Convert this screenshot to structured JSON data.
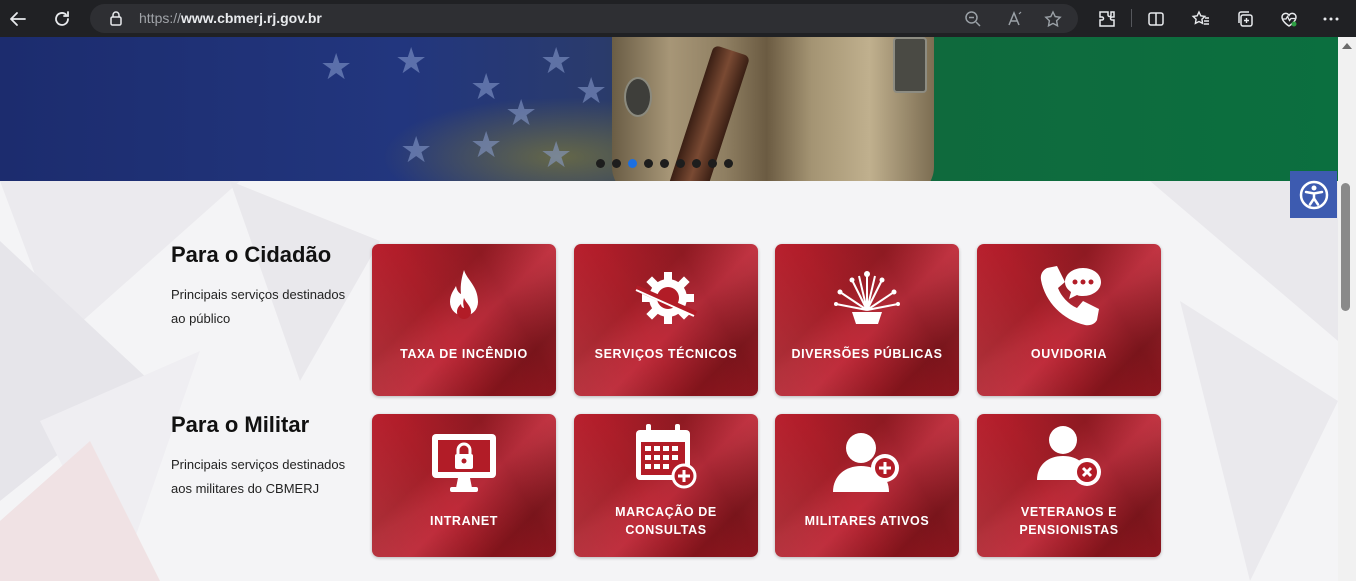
{
  "browser": {
    "url_protocol": "https://",
    "url_host": "www.cbmerj.rj.gov.br",
    "icons": [
      "back-icon",
      "refresh-icon",
      "lock-icon",
      "zoom-icon",
      "read-aloud-icon",
      "favorite-icon",
      "extensions-icon",
      "split-screen-icon",
      "favorites-bar-icon",
      "collections-icon",
      "browser-essentials-icon",
      "more-icon"
    ]
  },
  "hero": {
    "carousel_count": 9,
    "active_index": 2
  },
  "sections": [
    {
      "title": "Para o Cidadão",
      "description": "Principais serviços destinados ao público",
      "cards": [
        {
          "label": "TAXA DE INCÊNDIO",
          "icon": "fire-icon"
        },
        {
          "label": "SERVIÇOS TÉCNICOS",
          "icon": "gear-icon"
        },
        {
          "label": "DIVERSÕES PÚBLICAS",
          "icon": "fireworks-icon"
        },
        {
          "label": "OUVIDORIA",
          "icon": "phone-chat-icon"
        }
      ]
    },
    {
      "title": "Para o Militar",
      "description": "Principais serviços destinados aos militares do CBMERJ",
      "cards": [
        {
          "label": "INTRANET",
          "icon": "monitor-lock-icon"
        },
        {
          "label": "MARCAÇÃO DE CONSULTAS",
          "icon": "calendar-plus-icon"
        },
        {
          "label": "MILITARES ATIVOS",
          "icon": "user-plus-icon"
        },
        {
          "label": "VETERANOS E PENSIONISTAS",
          "icon": "user-remove-icon"
        }
      ]
    }
  ],
  "accessibility": {
    "icon": "accessibility-icon"
  },
  "colors": {
    "card_red": "#b01b26",
    "accent_blue": "#1c6fe0",
    "a11y_blue": "#3d5bb0"
  }
}
